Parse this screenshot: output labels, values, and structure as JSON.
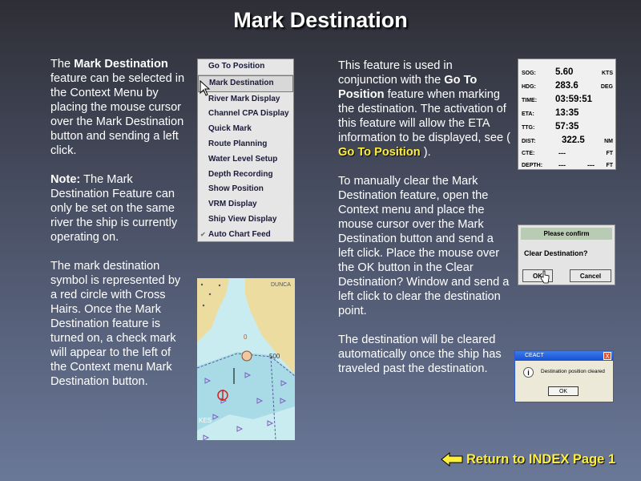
{
  "title": "Mark Destination",
  "left_text": {
    "p1_a": "The ",
    "p1_b": "Mark Destination",
    "p1_c": " feature can be selected in the Context Menu by placing the mouse cursor over the Mark Destination button and sending a left click.",
    "p2_a": "Note:",
    "p2_b": "  The Mark Destination Feature can only be set on the same river the ship is currently operating on.",
    "p3": "The mark destination symbol is represented by a red circle with Cross Hairs. Once the Mark Destination feature is turned on, a check mark will appear to the left of the Context menu Mark Destination button."
  },
  "right_text": {
    "p1_a": "This feature is used in conjunction with the ",
    "p1_b": "Go To Position",
    "p1_c": " feature when marking the destination.  The activation of this feature will allow the ETA information to be displayed, see ",
    "p1_link_open": "( ",
    "p1_link": "Go To Position",
    "p1_link_close": " ).",
    "p2": "To manually clear the Mark Destination feature, open the Context menu and place the mouse cursor over the Mark Destination button and send a left click.  Place the mouse over the OK button in the Clear Destination? Window and send a left click  to clear the destination point.",
    "p3": "The destination will be cleared automatically once the ship has traveled past the destination."
  },
  "context_menu": {
    "items": [
      {
        "label": "Go To Position"
      },
      {
        "label": "Mark Destination"
      },
      {
        "label": "River Mark Display"
      },
      {
        "label": "Channel CPA Display"
      },
      {
        "label": "Quick Mark"
      },
      {
        "label": "Route Planning"
      },
      {
        "label": "Water Level Setup"
      },
      {
        "label": "Depth Recording"
      },
      {
        "label": "Show Position"
      },
      {
        "label": "VRM Display"
      },
      {
        "label": "Ship View Display"
      },
      {
        "label": "Auto Chart Feed"
      }
    ]
  },
  "chart": {
    "label_duncan": "DUNCA",
    "label_kes": "KES",
    "depth_500": "500",
    "depth_0": "0",
    "colors": {
      "land": "#ecdca0",
      "water": "#c8ecf0",
      "channel": "#a8dbe6",
      "mark": "#d82020"
    }
  },
  "instruments": {
    "rows": [
      {
        "label": "SOG:",
        "value": "5.60",
        "unit": "KTS"
      },
      {
        "label": "HDG:",
        "value": "283.6",
        "unit": "DEG"
      },
      {
        "label": "TIME:",
        "value": "03:59:51",
        "unit": ""
      },
      {
        "label": "ETA:",
        "value": "13:35",
        "unit": ""
      },
      {
        "label": "TTG:",
        "value": "57:35",
        "unit": ""
      },
      {
        "label": "DIST:",
        "value": "322.5",
        "unit": "NM"
      },
      {
        "label": "CTE:",
        "value": "---",
        "unit": "FT"
      },
      {
        "label": "DEPTH:",
        "value": "---",
        "value2": "---",
        "unit": "FT"
      }
    ]
  },
  "confirm_dialog": {
    "title": "Please confirm",
    "message": "Clear Destination?",
    "ok": "OK",
    "cancel": "Cancel"
  },
  "alert_dialog": {
    "title": "CEACT",
    "close": "X",
    "icon": "i",
    "message": "Destination position cleared",
    "ok": "OK"
  },
  "return_link": {
    "label": "Return to INDEX Page 1",
    "arrow_color": "#ffef3a"
  }
}
